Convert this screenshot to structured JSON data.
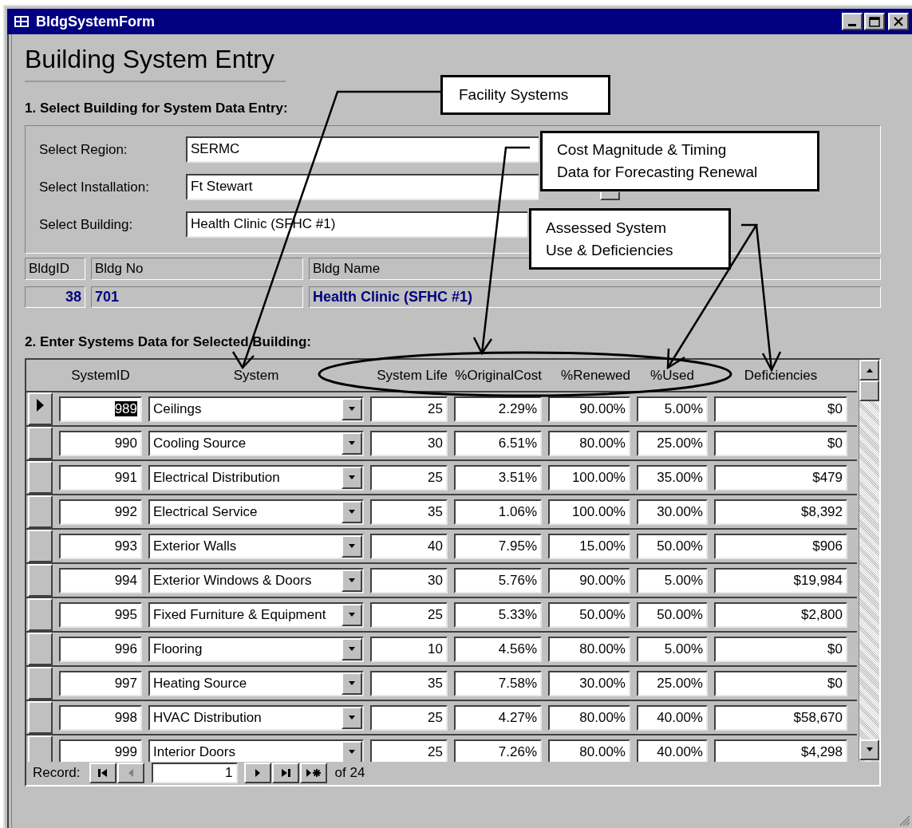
{
  "window": {
    "title": "BldgSystemForm"
  },
  "heading": "Building System Entry",
  "section_1": {
    "title": "1. Select Building for System Data Entry:",
    "fields": [
      {
        "label": "Select Region:",
        "value": "SERMC"
      },
      {
        "label": "Select Installation:",
        "value": "Ft Stewart"
      },
      {
        "label": "Select Building:",
        "value": "Health Clinic (SFHC #1)"
      }
    ]
  },
  "building_info": {
    "columns": [
      "BldgID",
      "Bldg No",
      "Bldg Name"
    ],
    "values": [
      "38",
      "701",
      "Health Clinic (SFHC #1)"
    ]
  },
  "section_2": {
    "title": "2. Enter Systems Data for Selected Building:"
  },
  "table": {
    "columns": [
      "SystemID",
      "System",
      "System Life",
      "%OriginalCost",
      "%Renewed",
      "%Used",
      "Deficiencies"
    ],
    "rows": [
      {
        "selected": true,
        "cells": [
          "989",
          "Ceilings",
          "25",
          "2.29%",
          "90.00%",
          "5.00%",
          "$0"
        ]
      },
      {
        "selected": false,
        "cells": [
          "990",
          "Cooling Source",
          "30",
          "6.51%",
          "80.00%",
          "25.00%",
          "$0"
        ]
      },
      {
        "selected": false,
        "cells": [
          "991",
          "Electrical Distribution",
          "25",
          "3.51%",
          "100.00%",
          "35.00%",
          "$479"
        ]
      },
      {
        "selected": false,
        "cells": [
          "992",
          "Electrical Service",
          "35",
          "1.06%",
          "100.00%",
          "30.00%",
          "$8,392"
        ]
      },
      {
        "selected": false,
        "cells": [
          "993",
          "Exterior Walls",
          "40",
          "7.95%",
          "15.00%",
          "50.00%",
          "$906"
        ]
      },
      {
        "selected": false,
        "cells": [
          "994",
          "Exterior Windows & Doors",
          "30",
          "5.76%",
          "90.00%",
          "5.00%",
          "$19,984"
        ]
      },
      {
        "selected": false,
        "cells": [
          "995",
          "Fixed Furniture & Equipment",
          "25",
          "5.33%",
          "50.00%",
          "50.00%",
          "$2,800"
        ]
      },
      {
        "selected": false,
        "cells": [
          "996",
          "Flooring",
          "10",
          "4.56%",
          "80.00%",
          "5.00%",
          "$0"
        ]
      },
      {
        "selected": false,
        "cells": [
          "997",
          "Heating Source",
          "35",
          "7.58%",
          "30.00%",
          "25.00%",
          "$0"
        ]
      },
      {
        "selected": false,
        "cells": [
          "998",
          "HVAC Distribution",
          "25",
          "4.27%",
          "80.00%",
          "40.00%",
          "$58,670"
        ]
      },
      {
        "selected": false,
        "cells": [
          "999",
          "Interior Doors",
          "25",
          "7.26%",
          "80.00%",
          "40.00%",
          "$4,298"
        ]
      }
    ]
  },
  "record_nav": {
    "label": "Record:",
    "current": "1",
    "total": "of 24",
    "buttons": [
      {
        "kind": "first",
        "disabled": false
      },
      {
        "kind": "prev",
        "disabled": true
      },
      {
        "kind": "next",
        "disabled": false
      },
      {
        "kind": "last",
        "disabled": false
      },
      {
        "kind": "new",
        "disabled": false
      }
    ]
  },
  "callouts": [
    {
      "lines": [
        "Facility Systems"
      ]
    },
    {
      "lines": [
        "Cost Magnitude & Timing",
        "Data for Forecasting Renewal"
      ]
    },
    {
      "lines": [
        "Assessed System",
        "Use & Deficiencies"
      ]
    }
  ]
}
